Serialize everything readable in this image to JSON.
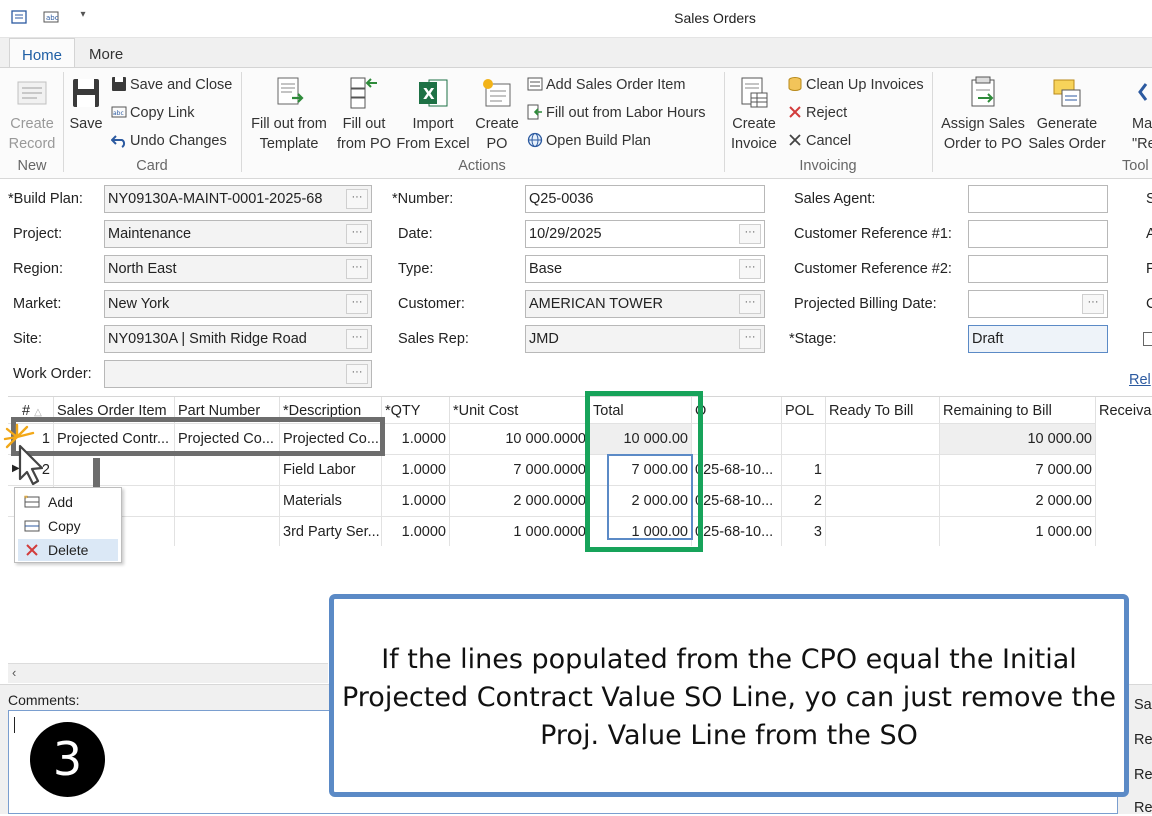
{
  "window": {
    "title": "Sales Orders"
  },
  "tabs": [
    {
      "label": "Home"
    },
    {
      "label": "More"
    }
  ],
  "ribbon": {
    "new": {
      "create_record": "Create\nRecord",
      "group": "New"
    },
    "card": {
      "save": "Save",
      "save_close": "Save and Close",
      "copy_link": "Copy Link",
      "undo": "Undo Changes",
      "group": "Card"
    },
    "actions": {
      "fill_template": "Fill out from\nTemplate",
      "fill_po": "Fill out\nfrom PO",
      "import_excel": "Import\nFrom Excel",
      "create_po": "Create\nPO",
      "add_item": "Add Sales Order Item",
      "fill_labor": "Fill out from Labor Hours",
      "open_build": "Open Build Plan",
      "group": "Actions"
    },
    "invoicing": {
      "create_invoice": "Create\nInvoice",
      "clean_up": "Clean Up Invoices",
      "reject": "Reject",
      "cancel": "Cancel",
      "group": "Invoicing"
    },
    "tools": {
      "assign": "Assign Sales\nOrder to PO",
      "generate": "Generate\nSales Order",
      "mark_partial": "Ma\n\"Read",
      "group": "Tool"
    }
  },
  "form": {
    "build_plan": {
      "label": "*Build Plan:",
      "value": "NY09130A-MAINT-0001-2025-68"
    },
    "project": {
      "label": "Project:",
      "value": "Maintenance"
    },
    "region": {
      "label": "Region:",
      "value": "North East"
    },
    "market": {
      "label": "Market:",
      "value": "New York"
    },
    "site": {
      "label": "Site:",
      "value": "NY09130A | Smith Ridge Road"
    },
    "work_order": {
      "label": "Work Order:",
      "value": ""
    },
    "number": {
      "label": "*Number:",
      "value": "Q25-0036"
    },
    "date": {
      "label": "Date:",
      "value": "10/29/2025"
    },
    "type": {
      "label": "Type:",
      "value": "Base"
    },
    "customer": {
      "label": "Customer:",
      "value": "AMERICAN TOWER"
    },
    "sales_rep": {
      "label": "Sales Rep:",
      "value": "JMD"
    },
    "sales_agent": {
      "label": "Sales Agent:",
      "value": ""
    },
    "cust_ref1": {
      "label": "Customer Reference #1:",
      "value": ""
    },
    "cust_ref2": {
      "label": "Customer Reference #2:",
      "value": ""
    },
    "proj_billing": {
      "label": "Projected Billing Date:",
      "value": ""
    },
    "stage": {
      "label": "*Stage:",
      "value": "Draft"
    },
    "right_edge_labels": [
      "S",
      "A",
      "F",
      "C"
    ],
    "rel_link": "Rel"
  },
  "grid": {
    "headers": [
      "#",
      "Sales Order Item",
      "Part Number",
      "*Description",
      "*QTY",
      "*Unit Cost",
      "Total",
      "O",
      "POL",
      "Ready To Bill",
      "Remaining to Bill",
      "Receival"
    ],
    "rows": [
      {
        "num": "1",
        "item": "Projected Contr...",
        "part": "Projected Co...",
        "desc": "Projected Co...",
        "qty": "1.0000",
        "unit": "10 000.0000",
        "total": "10 000.00",
        "po": "",
        "pol": "",
        "rtb": "",
        "rem": "10 000.00"
      },
      {
        "num": "2",
        "item": "",
        "part": "",
        "desc": "Field Labor",
        "qty": "1.0000",
        "unit": "7 000.0000",
        "total": "7 000.00",
        "po": "025-68-10...",
        "pol": "1",
        "rtb": "",
        "rem": "7 000.00"
      },
      {
        "num": "",
        "item": "",
        "part": "",
        "desc": "Materials",
        "qty": "1.0000",
        "unit": "2 000.0000",
        "total": "2 000.00",
        "po": "025-68-10...",
        "pol": "2",
        "rtb": "",
        "rem": "2 000.00"
      },
      {
        "num": "",
        "item": "",
        "part": "",
        "desc": "3rd Party Ser...",
        "qty": "1.0000",
        "unit": "1 000.0000",
        "total": "1 000.00",
        "po": "025-68-10...",
        "pol": "3",
        "rtb": "",
        "rem": "1 000.00"
      }
    ]
  },
  "context_menu": [
    {
      "label": "Add"
    },
    {
      "label": "Copy"
    },
    {
      "label": "Delete"
    }
  ],
  "comments_label": "Comments:",
  "right_bottom_labels": [
    "Sa",
    "Re",
    "Re",
    "Re"
  ],
  "callout": {
    "line1": "If the lines populated from the CPO equal the Initial",
    "line2": "Projected Contract Value SO Line, yo can just remove the",
    "line3": "Proj. Value Line from the SO"
  },
  "step_number": "3",
  "colors": {
    "accent": "#1f5fa5",
    "green_highlight": "#17a35a",
    "blue_box": "#5b8ac6",
    "gray_highlight": "#6d6d6d"
  }
}
